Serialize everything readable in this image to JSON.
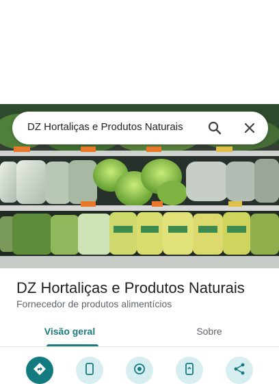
{
  "search": {
    "query": "DZ Hortaliças e Produtos Naturais",
    "search_icon": "search-icon",
    "close_icon": "close-icon"
  },
  "hero_photo": {
    "subject": "vegetable-shelf-photo"
  },
  "place": {
    "name": "DZ Hortaliças e Produtos Naturais",
    "category": "Fornecedor de produtos alimentícios"
  },
  "tabs": [
    {
      "label": "Visão geral",
      "selected": true
    },
    {
      "label": "Sobre",
      "selected": false
    }
  ],
  "actions": [
    {
      "icon": "directions-icon"
    },
    {
      "icon": "phone-icon"
    },
    {
      "icon": "nearby-icon"
    },
    {
      "icon": "send-to-phone-icon"
    },
    {
      "icon": "share-icon"
    }
  ],
  "colors": {
    "accent": "#1a7a7d",
    "action_primary": "#137a7f",
    "action_secondary": "#d7eef0"
  }
}
